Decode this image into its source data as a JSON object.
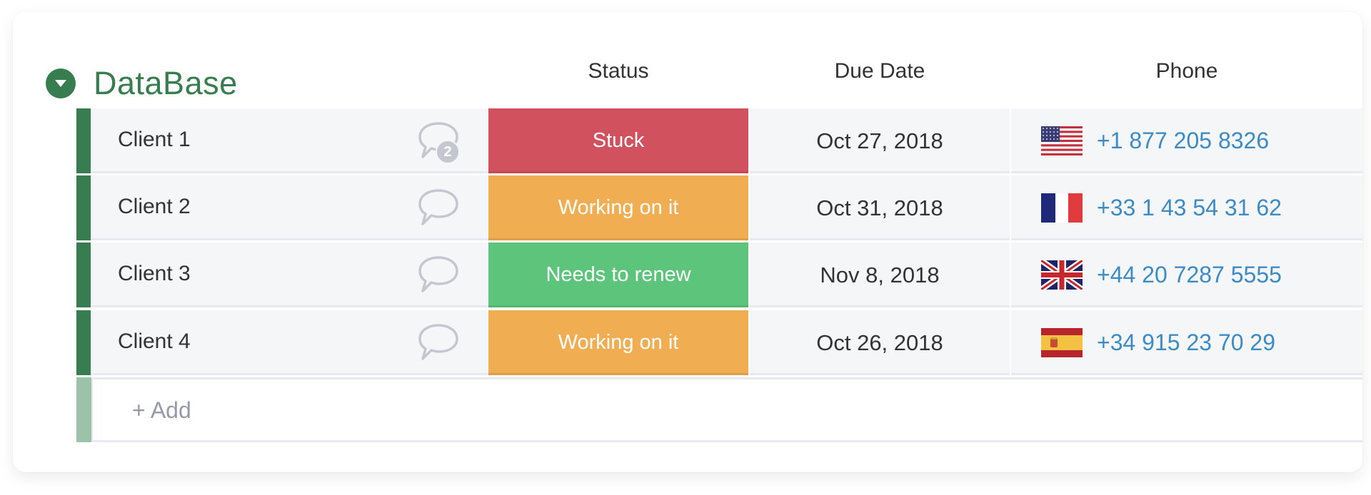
{
  "group": {
    "title": "DataBase",
    "color": "#377d4f",
    "collapse_icon": "chevron-down-circle-icon"
  },
  "columns": {
    "status": "Status",
    "due_date": "Due Date",
    "phone": "Phone"
  },
  "rows": [
    {
      "name": "Client 1",
      "comments": "2",
      "status": "Stuck",
      "status_color": "#d2515e",
      "due_date": "Oct 27, 2018",
      "flag": "us-flag-icon",
      "phone": "+1 877 205 8326"
    },
    {
      "name": "Client 2",
      "comments": "",
      "status": "Working on it",
      "status_color": "#f0ad52",
      "due_date": "Oct 31, 2018",
      "flag": "fr-flag-icon",
      "phone": "+33 1 43 54 31 62"
    },
    {
      "name": "Client 3",
      "comments": "",
      "status": "Needs to renew",
      "status_color": "#5cc57b",
      "due_date": "Nov 8, 2018",
      "flag": "uk-flag-icon",
      "phone": "+44 20 7287 5555"
    },
    {
      "name": "Client 4",
      "comments": "",
      "status": "Working on it",
      "status_color": "#f0ad52",
      "due_date": "Oct 26, 2018",
      "flag": "es-flag-icon",
      "phone": "+34 915 23 70 29"
    }
  ],
  "add_row": {
    "label": "+ Add"
  },
  "colors": {
    "phone_link": "#3c8bc4",
    "row_bg": "#f5f6f8",
    "add_bar": "#9cc3aa"
  }
}
